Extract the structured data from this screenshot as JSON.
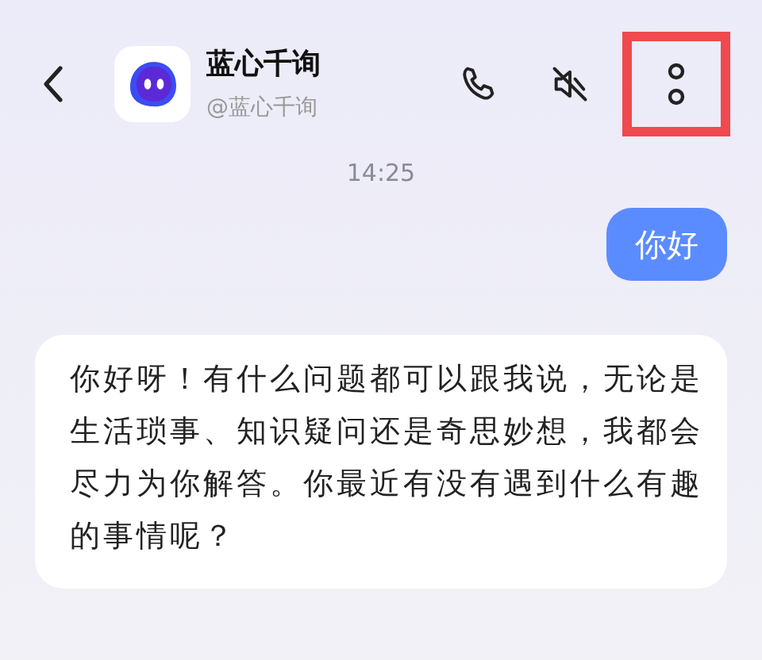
{
  "header": {
    "name": "蓝心千询",
    "handle": "@蓝心千询"
  },
  "messages": [
    {
      "kind": "time",
      "text": "14:25"
    },
    {
      "kind": "user",
      "text": "你好"
    },
    {
      "kind": "assistant",
      "text": "你好呀！有什么问题都可以跟我说，无论是生活琐事、知识疑问还是奇思妙想，我都会尽力为你解答。你最近有没有遇到什么有趣的事情呢？"
    }
  ]
}
